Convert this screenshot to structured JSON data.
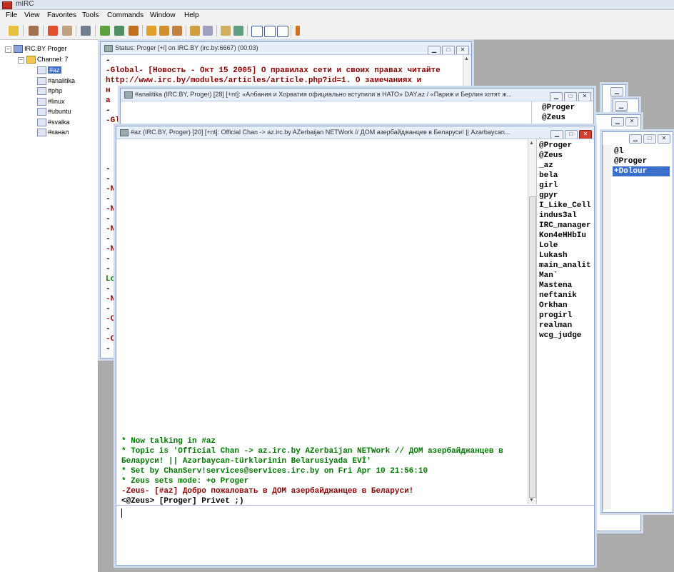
{
  "app": {
    "title": "mIRC"
  },
  "menu": [
    "File",
    "View",
    "Favorites",
    "Tools",
    "Commands",
    "Window",
    "Help"
  ],
  "toolbar_icons": [
    "connect-icon",
    "options-icon",
    "channels-icon",
    "address-book-icon",
    "notify-icon",
    "aliases-icon",
    "popups-icon",
    "scripts-icon",
    "dcc-send-icon",
    "dcc-chat-icon",
    "dcc-get-icon",
    "url-list-icon",
    "log-icon",
    "received-files-icon",
    "colors-icon",
    "tile-horizontal-icon",
    "tile-vertical-icon",
    "cascade-icon",
    "help-icon"
  ],
  "treebar": {
    "server": "IRC.BY Proger",
    "folder": "Channel: 7",
    "channels": [
      "#az",
      "#analitika",
      "#php",
      "#linux",
      "#ubuntu",
      "#svalka",
      "#канал"
    ]
  },
  "status_window": {
    "title": "Status: Proger [+i] on IRC.BY (irc.by:6667) (00:03)",
    "lines": [
      {
        "text": "-",
        "color": "black"
      },
      {
        "text": "-Global- [Новость - Окт 15 2005] О правилах сети и своих правах читайте",
        "color": "dred"
      },
      {
        "text": " http://www.irc.by/modules/articles/article.php?id=1. О замечаниях и",
        "color": "dred"
      },
      {
        "text": " н",
        "color": "dred"
      },
      {
        "text": " а",
        "color": "dred"
      },
      {
        "text": "-",
        "color": "black"
      },
      {
        "text": "-Gl",
        "color": "dred"
      },
      {
        "text": "-",
        "color": "black"
      },
      {
        "text": "-",
        "color": "black"
      },
      {
        "text": "-N",
        "color": "dred"
      },
      {
        "text": "-",
        "color": "black"
      },
      {
        "text": "-N",
        "color": "dred"
      },
      {
        "text": "-",
        "color": "black"
      },
      {
        "text": "-N",
        "color": "dred"
      },
      {
        "text": "-",
        "color": "black"
      },
      {
        "text": "-N",
        "color": "dred"
      },
      {
        "text": "-",
        "color": "black"
      },
      {
        "text": "-",
        "color": "black"
      },
      {
        "text": "Lo",
        "color": "green"
      },
      {
        "text": "-",
        "color": "black"
      },
      {
        "text": "-N",
        "color": "dred"
      },
      {
        "text": "-",
        "color": "black"
      },
      {
        "text": "-C",
        "color": "dred"
      },
      {
        "text": "-",
        "color": "black"
      },
      {
        "text": "-C",
        "color": "dred"
      },
      {
        "text": "-",
        "color": "black"
      }
    ]
  },
  "analitika_window": {
    "title": "#analitika (IRC.BY, Proger) [28] [+nt]: «Албания и Хорватия официально вступили в НАТО» DAY.az / «Париж и Берлин хотят ж...",
    "nicks": [
      "@Proger",
      "@Zeus"
    ]
  },
  "back_window": {
    "nicks": [
      "@l",
      "@Proger",
      "+Dolour"
    ]
  },
  "az_window": {
    "title": "#az (IRC.BY, Proger) [20] [+nt]: Official Chan -> az.irc.by AZerbaijan NETWork // ДОМ азербайджанцев в Беларуси! || Azarbaycan...",
    "messages": [
      {
        "text": "* Now talking in #az",
        "color": "green"
      },
      {
        "text": "* Topic is 'Official Chan -> az.irc.by AZerbaijan NETWork // ДОМ азербайджанцев в",
        "color": "green"
      },
      {
        "text": "Беларуси! || Azərbaycan-türklərinin Belarusiyada EVİ'",
        "color": "green"
      },
      {
        "text": "* Set by ChanServ!services@services.irc.by on Fri Apr 10 21:56:10",
        "color": "green"
      },
      {
        "text": "* Zeus sets mode: +o Proger",
        "color": "green"
      },
      {
        "text": "-Zeus- [#az] Добро пожаловать в ДОМ азербайджанцев в Беларуси!",
        "color": "dred"
      },
      {
        "text": "<@Zeus> [Proger] Privet ;)",
        "color": "black"
      }
    ],
    "nicks": [
      "@Proger",
      "@Zeus",
      "_az",
      "bela",
      "girl",
      "gpyr",
      "I_Like_Cell",
      "indus3al",
      "IRC_manager",
      "Kon4eHHbIu",
      "Lole",
      "Lukash",
      "main_analit",
      "Man`",
      "Mastena",
      "neftanik",
      "Orkhan",
      "progirl",
      "realman",
      "wcg_judge"
    ]
  },
  "window_buttons": {
    "minimize": "▁",
    "maximize": "□",
    "close": "✕"
  },
  "colors": {
    "accent": "#3b6fcc",
    "green": "#007800",
    "dark_red": "#8a0000"
  }
}
